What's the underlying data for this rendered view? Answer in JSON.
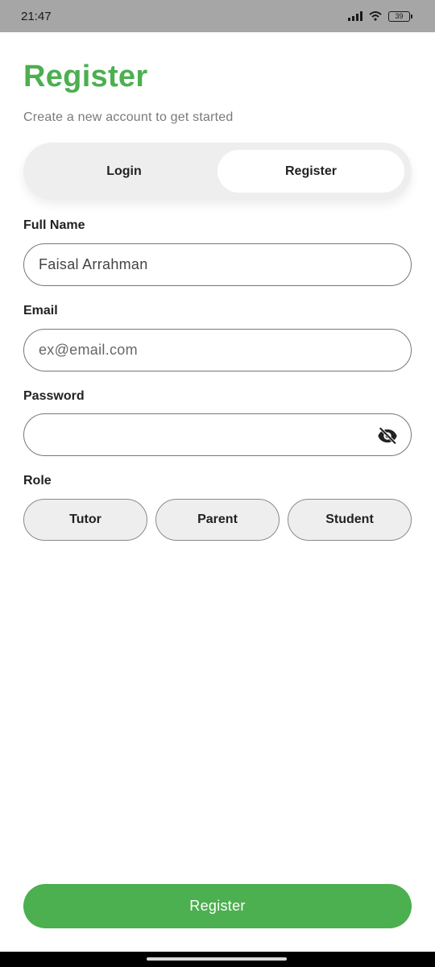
{
  "status": {
    "time": "21:47",
    "battery": "39"
  },
  "screen": {
    "title": "Register",
    "subtitle": "Create a new account to get started"
  },
  "auth_tabs": [
    {
      "label": "Login",
      "active": false
    },
    {
      "label": "Register",
      "active": true
    }
  ],
  "form": {
    "full_name": {
      "label": "Full Name",
      "value": "Faisal Arrahman"
    },
    "email": {
      "label": "Email",
      "placeholder": "ex@email.com"
    },
    "password": {
      "label": "Password",
      "value": "",
      "toggle_icon": "eye-off-icon"
    },
    "role": {
      "label": "Role",
      "options": [
        "Tutor",
        "Parent",
        "Student"
      ]
    }
  },
  "submit": {
    "label": "Register"
  },
  "colors": {
    "accent": "#4caf50",
    "segment_bg": "#eeeeee",
    "status_bar": "#a6a6a6"
  }
}
